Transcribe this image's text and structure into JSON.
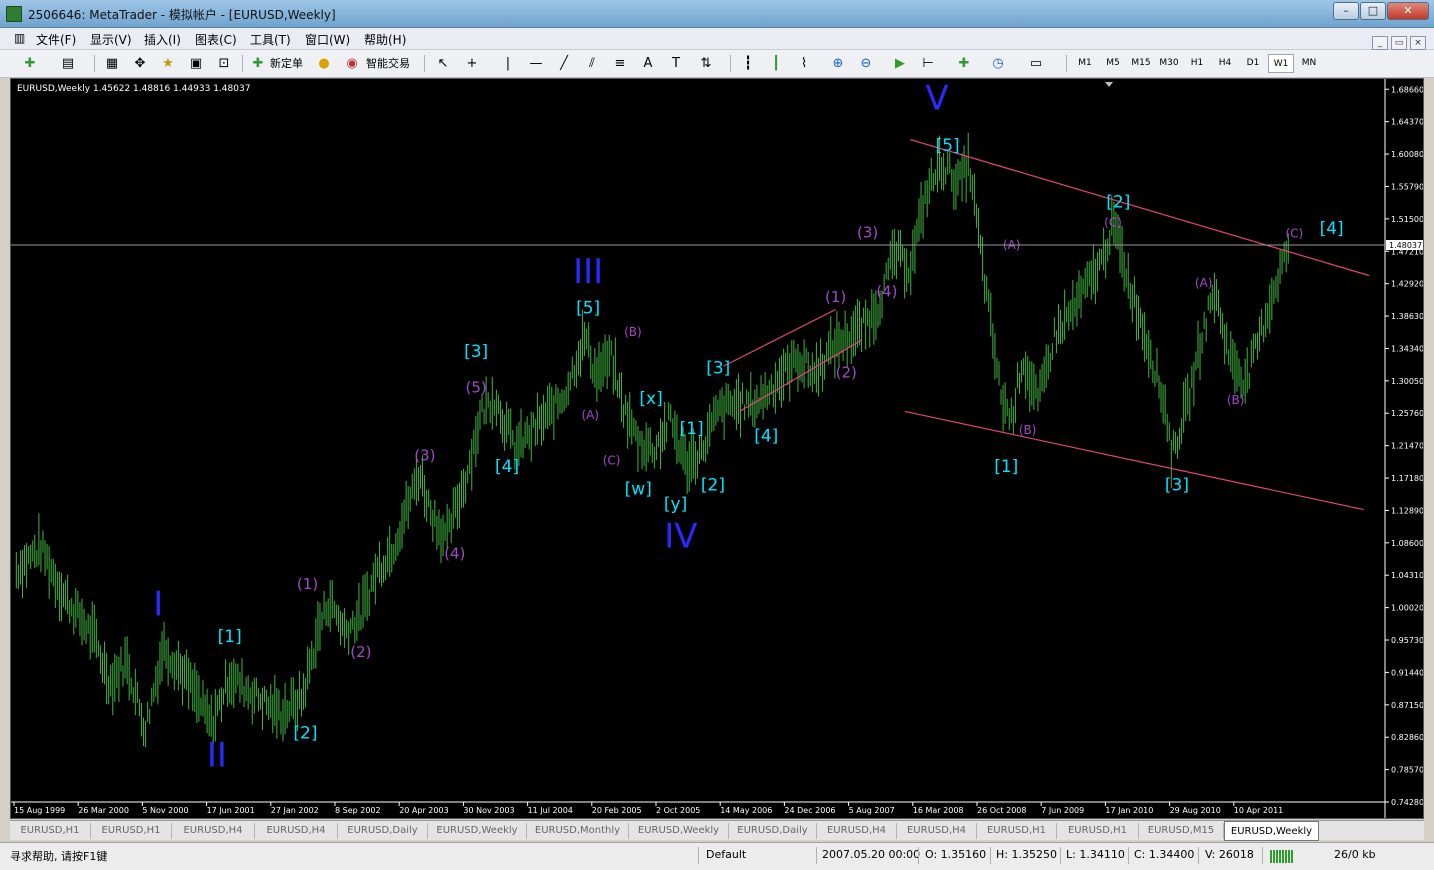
{
  "window": {
    "title": "2506646: MetaTrader - 模拟帐户 - [EURUSD,Weekly]"
  },
  "menu": [
    "文件(F)",
    "显示(V)",
    "插入(I)",
    "图表(C)",
    "工具(T)",
    "窗口(W)",
    "帮助(H)"
  ],
  "toolbar": {
    "new_order": "新定单",
    "expert": "智能交易",
    "timeframes": [
      "M1",
      "M5",
      "M15",
      "M30",
      "H1",
      "H4",
      "D1",
      "W1",
      "MN"
    ],
    "active_timeframe": "W1"
  },
  "chart_info": "EURUSD,Weekly  1.45622 1.48816 1.44933 1.48037",
  "current_price": "1.48037",
  "chart_data": {
    "type": "bar",
    "symbol": "EURUSD",
    "timeframe": "Weekly",
    "ohlc_last": {
      "open": 1.45622,
      "high": 1.48816,
      "low": 1.44933,
      "close": 1.48037
    },
    "ylim": [
      0.7428,
      1.7002
    ],
    "price_ticks": [
      "1.68660",
      "1.64370",
      "1.60080",
      "1.55790",
      "1.51500",
      "1.47210",
      "1.42920",
      "1.38630",
      "1.34340",
      "1.30050",
      "1.25760",
      "1.21470",
      "1.17180",
      "1.12890",
      "1.08600",
      "1.04310",
      "1.00020",
      "0.95730",
      "0.91440",
      "0.87150",
      "0.82860",
      "0.78570",
      "0.74280"
    ],
    "time_labels": [
      "15 Aug 1999",
      "26 Mar 2000",
      "5 Nov 2000",
      "17 Jun 2001",
      "27 Jan 2002",
      "8 Sep 2002",
      "20 Apr 2003",
      "30 Nov 2003",
      "11 Jul 2004",
      "20 Feb 2005",
      "2 Oct 2005",
      "14 May 2006",
      "24 Dec 2006",
      "5 Aug 2007",
      "16 Mar 2008",
      "26 Oct 2008",
      "7 Jun 2009",
      "17 Jan 2010",
      "29 Aug 2010",
      "10 Apr 2011"
    ],
    "path": [
      [
        1999.62,
        1.05
      ],
      [
        1999.85,
        1.08
      ],
      [
        2000.05,
        1.02
      ],
      [
        2000.35,
        0.96
      ],
      [
        2000.5,
        0.9
      ],
      [
        2000.65,
        0.93
      ],
      [
        2000.83,
        0.84
      ],
      [
        2001.0,
        0.95
      ],
      [
        2001.2,
        0.91
      ],
      [
        2001.45,
        0.845
      ],
      [
        2001.62,
        0.91
      ],
      [
        2001.8,
        0.89
      ],
      [
        2001.95,
        0.875
      ],
      [
        2002.1,
        0.86
      ],
      [
        2002.3,
        0.88
      ],
      [
        2002.45,
        0.97
      ],
      [
        2002.55,
        1.01
      ],
      [
        2002.7,
        0.97
      ],
      [
        2002.85,
        0.99
      ],
      [
        2003.0,
        1.05
      ],
      [
        2003.15,
        1.08
      ],
      [
        2003.4,
        1.18
      ],
      [
        2003.5,
        1.13
      ],
      [
        2003.65,
        1.09
      ],
      [
        2003.85,
        1.18
      ],
      [
        2003.98,
        1.26
      ],
      [
        2004.1,
        1.28
      ],
      [
        2004.3,
        1.21
      ],
      [
        2004.5,
        1.24
      ],
      [
        2004.75,
        1.28
      ],
      [
        2004.95,
        1.36
      ],
      [
        2005.05,
        1.31
      ],
      [
        2005.2,
        1.33
      ],
      [
        2005.3,
        1.27
      ],
      [
        2005.45,
        1.22
      ],
      [
        2005.6,
        1.21
      ],
      [
        2005.75,
        1.25
      ],
      [
        2005.9,
        1.19
      ],
      [
        2006.05,
        1.21
      ],
      [
        2006.2,
        1.26
      ],
      [
        2006.35,
        1.27
      ],
      [
        2006.55,
        1.27
      ],
      [
        2006.75,
        1.3
      ],
      [
        2006.95,
        1.33
      ],
      [
        2007.1,
        1.31
      ],
      [
        2007.3,
        1.35
      ],
      [
        2007.55,
        1.37
      ],
      [
        2007.7,
        1.4
      ],
      [
        2007.85,
        1.47
      ],
      [
        2008.0,
        1.45
      ],
      [
        2008.15,
        1.55
      ],
      [
        2008.3,
        1.59
      ],
      [
        2008.45,
        1.56
      ],
      [
        2008.55,
        1.59
      ],
      [
        2008.7,
        1.43
      ],
      [
        2008.85,
        1.28
      ],
      [
        2008.95,
        1.25
      ],
      [
        2009.05,
        1.33
      ],
      [
        2009.2,
        1.27
      ],
      [
        2009.35,
        1.36
      ],
      [
        2009.55,
        1.4
      ],
      [
        2009.8,
        1.46
      ],
      [
        2009.9,
        1.51
      ],
      [
        2010.05,
        1.43
      ],
      [
        2010.25,
        1.34
      ],
      [
        2010.4,
        1.26
      ],
      [
        2010.45,
        1.2
      ],
      [
        2010.6,
        1.27
      ],
      [
        2010.75,
        1.37
      ],
      [
        2010.85,
        1.42
      ],
      [
        2011.0,
        1.33
      ],
      [
        2011.15,
        1.3
      ],
      [
        2011.3,
        1.37
      ],
      [
        2011.45,
        1.44
      ],
      [
        2011.55,
        1.48
      ]
    ],
    "trendlines": [
      {
        "from": [
          2008.0,
          1.62
        ],
        "to": [
          2012.3,
          1.44
        ]
      },
      {
        "from": [
          2007.95,
          1.26
        ],
        "to": [
          2012.25,
          1.13
        ]
      },
      {
        "from": [
          2006.25,
          1.32
        ],
        "to": [
          2007.3,
          1.395
        ]
      },
      {
        "from": [
          2006.4,
          1.26
        ],
        "to": [
          2007.55,
          1.355
        ]
      }
    ],
    "annotations": [
      {
        "text": "I",
        "x": 2000.95,
        "y": 0.99,
        "style": "wave-primary"
      },
      {
        "text": "II",
        "x": 2001.5,
        "y": 0.79,
        "style": "wave-primary"
      },
      {
        "text": "III",
        "x": 2004.98,
        "y": 1.43,
        "style": "wave-primary"
      },
      {
        "text": "IV",
        "x": 2005.85,
        "y": 1.08,
        "style": "wave-primary"
      },
      {
        "text": "V",
        "x": 2008.25,
        "y": 1.66,
        "style": "wave-primary"
      },
      {
        "text": "[1]",
        "x": 2001.62,
        "y": 0.955,
        "style": "wave-bracket"
      },
      {
        "text": "[2]",
        "x": 2002.33,
        "y": 0.827,
        "style": "wave-bracket"
      },
      {
        "text": "[3]",
        "x": 2003.93,
        "y": 1.332,
        "style": "wave-bracket"
      },
      {
        "text": "[4]",
        "x": 2004.22,
        "y": 1.18,
        "style": "wave-bracket"
      },
      {
        "text": "[5]",
        "x": 2004.98,
        "y": 1.39,
        "style": "wave-bracket"
      },
      {
        "text": "[x]",
        "x": 2005.57,
        "y": 1.27,
        "style": "wave-bracket"
      },
      {
        "text": "[1]",
        "x": 2005.95,
        "y": 1.23,
        "style": "wave-bracket"
      },
      {
        "text": "[w]",
        "x": 2005.45,
        "y": 1.15,
        "style": "wave-bracket"
      },
      {
        "text": "[y]",
        "x": 2005.8,
        "y": 1.13,
        "style": "wave-bracket"
      },
      {
        "text": "[2]",
        "x": 2006.15,
        "y": 1.155,
        "style": "wave-bracket"
      },
      {
        "text": "[3]",
        "x": 2006.2,
        "y": 1.31,
        "style": "wave-bracket"
      },
      {
        "text": "[4]",
        "x": 2006.65,
        "y": 1.22,
        "style": "wave-bracket"
      },
      {
        "text": "[5]",
        "x": 2008.35,
        "y": 1.605,
        "style": "wave-bracket"
      },
      {
        "text": "[1]",
        "x": 2008.9,
        "y": 1.18,
        "style": "wave-bracket"
      },
      {
        "text": "[2]",
        "x": 2009.95,
        "y": 1.53,
        "style": "wave-bracket"
      },
      {
        "text": "[3]",
        "x": 2010.5,
        "y": 1.155,
        "style": "wave-bracket"
      },
      {
        "text": "[4]",
        "x": 2011.95,
        "y": 1.495,
        "style": "wave-bracket"
      },
      {
        "text": "(1)",
        "x": 2002.35,
        "y": 1.025,
        "style": "wave-minor"
      },
      {
        "text": "(2)",
        "x": 2002.85,
        "y": 0.935,
        "style": "wave-minor"
      },
      {
        "text": "(3)",
        "x": 2003.45,
        "y": 1.195,
        "style": "wave-minor"
      },
      {
        "text": "(4)",
        "x": 2003.73,
        "y": 1.065,
        "style": "wave-minor"
      },
      {
        "text": "(5)",
        "x": 2003.93,
        "y": 1.285,
        "style": "wave-minor"
      },
      {
        "text": "(B)",
        "x": 2005.4,
        "y": 1.36,
        "style": "wave-minor-small"
      },
      {
        "text": "(A)",
        "x": 2005.0,
        "y": 1.25,
        "style": "wave-minor-small"
      },
      {
        "text": "(C)",
        "x": 2005.2,
        "y": 1.19,
        "style": "wave-minor-small"
      },
      {
        "text": "(1)",
        "x": 2007.3,
        "y": 1.405,
        "style": "wave-minor"
      },
      {
        "text": "(2)",
        "x": 2007.4,
        "y": 1.305,
        "style": "wave-minor"
      },
      {
        "text": "(3)",
        "x": 2007.6,
        "y": 1.49,
        "style": "wave-minor"
      },
      {
        "text": "(4)",
        "x": 2007.78,
        "y": 1.412,
        "style": "wave-minor"
      },
      {
        "text": "(A)",
        "x": 2008.95,
        "y": 1.475,
        "style": "wave-minor-small"
      },
      {
        "text": "(B)",
        "x": 2009.1,
        "y": 1.23,
        "style": "wave-minor-small"
      },
      {
        "text": "(C)",
        "x": 2009.9,
        "y": 1.505,
        "style": "wave-minor-small"
      },
      {
        "text": "(A)",
        "x": 2010.75,
        "y": 1.425,
        "style": "wave-minor-small"
      },
      {
        "text": "(B)",
        "x": 2011.05,
        "y": 1.27,
        "style": "wave-minor-small"
      },
      {
        "text": "(C)",
        "x": 2011.6,
        "y": 1.49,
        "style": "wave-minor-small"
      }
    ]
  },
  "tabs": [
    "EURUSD,H1",
    "EURUSD,H1",
    "EURUSD,H4",
    "EURUSD,H4",
    "EURUSD,Daily",
    "EURUSD,Weekly",
    "EURUSD,Monthly",
    "EURUSD,Weekly",
    "EURUSD,Daily",
    "EURUSD,H4",
    "EURUSD,H4",
    "EURUSD,H1",
    "EURUSD,H1",
    "EURUSD,M15",
    "EURUSD,Weekly"
  ],
  "active_tab_index": 14,
  "status": {
    "help": "寻求帮助, 请按F1键",
    "profile": "Default",
    "datetime": "2007.05.20 00:00",
    "open": "O: 1.35160",
    "high": "H: 1.35250",
    "low": "L: 1.34110",
    "close": "C: 1.34400",
    "volume": "V: 26018",
    "traffic": "26/0 kb"
  },
  "colors": {
    "bars": "#3fb53f",
    "trendline": "#e0457b",
    "wave_primary": "#2a2aff",
    "wave_bracket": "#00e5ff",
    "wave_minor": "#a349c8",
    "grid_text": "#ffffff"
  }
}
